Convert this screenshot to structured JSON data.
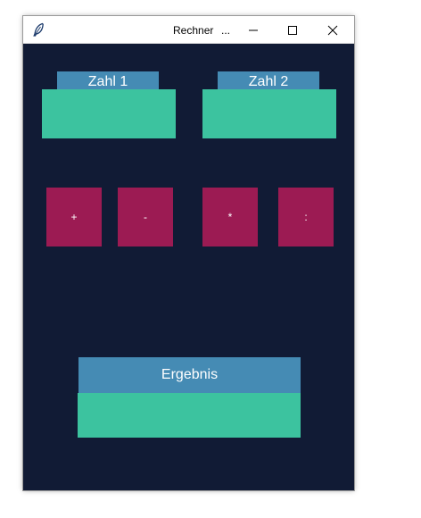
{
  "window": {
    "title": "Rechner",
    "title_overflow": "..."
  },
  "titlebar_controls": {
    "minimize": "minimize-icon",
    "maximize": "maximize-icon",
    "close": "close-icon"
  },
  "inputs": {
    "zahl1": {
      "label": "Zahl 1",
      "value": ""
    },
    "zahl2": {
      "label": "Zahl 2",
      "value": ""
    }
  },
  "operators": [
    {
      "label": "+"
    },
    {
      "label": "-"
    },
    {
      "label": "*"
    },
    {
      "label": ":"
    }
  ],
  "result": {
    "label": "Ergebnis",
    "value": ""
  },
  "colors": {
    "background": "#111b35",
    "label_blue": "#458bb4",
    "field_green": "#3cc39f",
    "button_magenta": "#9c1b53"
  }
}
